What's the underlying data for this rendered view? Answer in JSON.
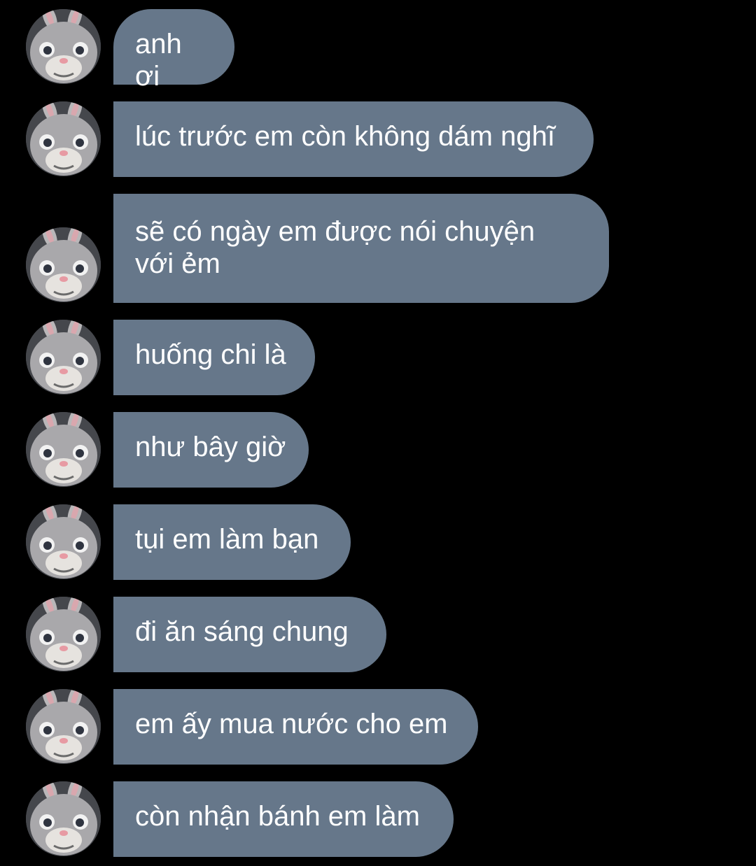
{
  "colors": {
    "background": "#000000",
    "bubble": "#66778a",
    "text": "#ffffff"
  },
  "avatar_icon": "bunny-mascot-avatar",
  "messages": [
    {
      "text": "anh ơi"
    },
    {
      "text": "lúc trước em còn không dám nghĩ"
    },
    {
      "text": "sẽ có ngày em được nói chuyện\nvới ẻm"
    },
    {
      "text": "huống chi là"
    },
    {
      "text": "như bây giờ"
    },
    {
      "text": "tụi em làm bạn"
    },
    {
      "text": "đi ăn sáng chung"
    },
    {
      "text": "em ấy mua nước cho em"
    },
    {
      "text": "còn nhận bánh em làm"
    }
  ]
}
